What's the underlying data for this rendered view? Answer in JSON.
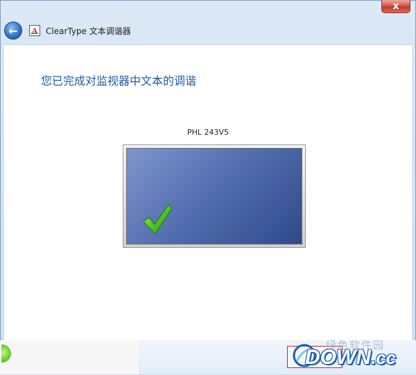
{
  "window": {
    "close_glyph": "x",
    "back_glyph": "←",
    "title": "ClearType 文本调谐器",
    "app_icon_letter": "A"
  },
  "content": {
    "heading": "您已完成对监视器中文本的调谐",
    "monitor_name": "PHL 243V5"
  },
  "watermark": {
    "faint_text": "绿色软件园",
    "brand_main": "DOWN",
    "brand_suffix": ".cc"
  },
  "colors": {
    "heading": "#1f5aa6",
    "screen": "#5570b1",
    "check": "#3fae1c",
    "close": "#c0392b"
  }
}
